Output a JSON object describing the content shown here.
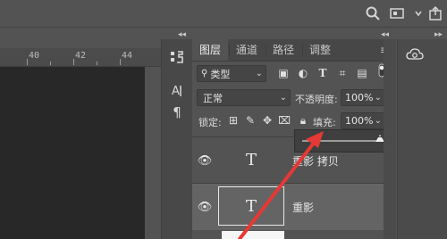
{
  "topbar": {
    "icons": [
      "search-icon",
      "workspace-icon",
      "dropdown-icon",
      "share-icon"
    ]
  },
  "ruler": {
    "labels": [
      "40",
      "42",
      "44"
    ]
  },
  "toolstrip": {
    "tools": [
      "character-icon",
      "paragraph-icon",
      "brush-icon"
    ]
  },
  "layers_panel": {
    "tabs": [
      "图层",
      "通道",
      "路径",
      "调整"
    ],
    "filter": {
      "label": "类型",
      "icons": [
        "image-filter-icon",
        "adjustment-filter-icon",
        "text-filter-icon",
        "shape-filter-icon",
        "smart-object-filter-icon",
        "toggle-icon"
      ]
    },
    "blend_mode": "正常",
    "opacity_label": "不透明度:",
    "opacity_value": "100%",
    "lock_label": "锁定:",
    "fill_label": "填充:",
    "fill_value": "100%",
    "slider_value": 100,
    "layers": [
      {
        "name": "重影 拷贝",
        "thumb": "T",
        "selected": false
      },
      {
        "name": "重影",
        "thumb": "T",
        "selected": true
      }
    ]
  },
  "colors": {
    "accent_arrow": "#e53935",
    "panel_bg": "#535353",
    "canvas_bg": "#282828",
    "selected_layer_bg": "#646464"
  }
}
